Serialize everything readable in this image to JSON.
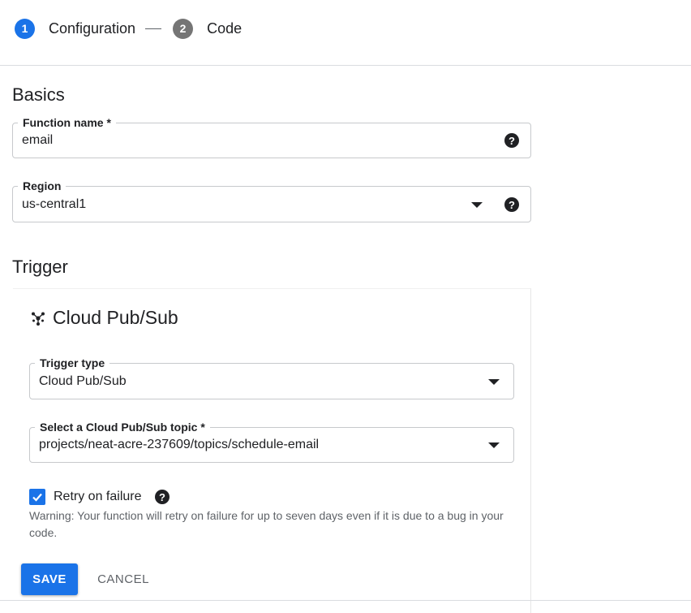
{
  "stepper": {
    "steps": [
      {
        "number": "1",
        "label": "Configuration"
      },
      {
        "number": "2",
        "label": "Code"
      }
    ]
  },
  "basics": {
    "title": "Basics",
    "function_name": {
      "label": "Function name *",
      "value": "email"
    },
    "region": {
      "label": "Region",
      "value": "us-central1"
    }
  },
  "trigger": {
    "title": "Trigger",
    "card_title": "Cloud Pub/Sub",
    "trigger_type": {
      "label": "Trigger type",
      "value": "Cloud Pub/Sub"
    },
    "topic": {
      "label": "Select a Cloud Pub/Sub topic *",
      "value": "projects/neat-acre-237609/topics/schedule-email"
    },
    "retry": {
      "label": "Retry on failure",
      "checked": true
    },
    "warning": "Warning: Your function will retry on failure for up to seven days even if it is due to a bug in your code."
  },
  "actions": {
    "save": "SAVE",
    "cancel": "CANCEL"
  },
  "icons": {
    "help": "help-circle-icon",
    "dropdown": "dropdown-arrow-icon",
    "pubsub": "pubsub-icon",
    "check": "check-icon"
  },
  "help_glyph": "?",
  "colors": {
    "primary": "#1a73e8",
    "step_inactive": "#757575",
    "text": "#202124",
    "muted": "#5f6368"
  }
}
